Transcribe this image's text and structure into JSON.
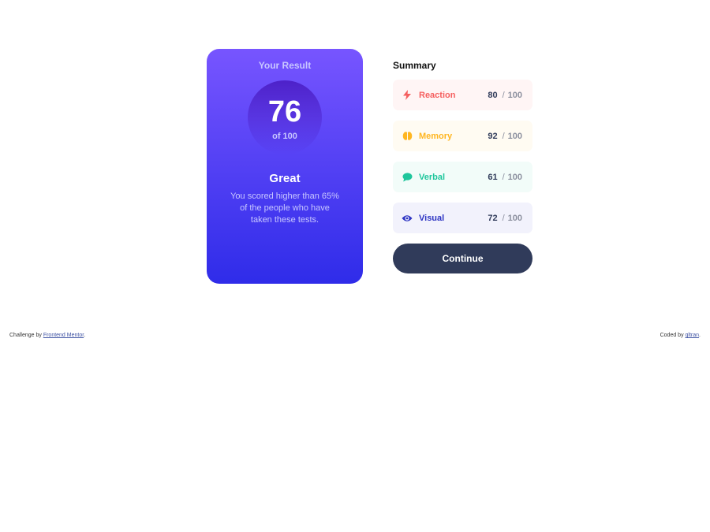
{
  "result": {
    "title": "Your Result",
    "score": "76",
    "out_of": "of 100",
    "rating": "Great",
    "description": "You scored higher than 65% of the people who have taken these tests."
  },
  "summary": {
    "title": "Summary",
    "items": [
      {
        "label": "Reaction",
        "score": "80",
        "sep": "/",
        "max": "100",
        "icon": "lightning-icon",
        "color": "#f55f5f",
        "bg": "#fff5f5"
      },
      {
        "label": "Memory",
        "score": "92",
        "sep": "/",
        "max": "100",
        "icon": "brain-icon",
        "color": "#ffb621",
        "bg": "#fffbf2"
      },
      {
        "label": "Verbal",
        "score": "61",
        "sep": "/",
        "max": "100",
        "icon": "chat-bubble-icon",
        "color": "#1fc69c",
        "bg": "#f2fcf9"
      },
      {
        "label": "Visual",
        "score": "72",
        "sep": "/",
        "max": "100",
        "icon": "eye-icon",
        "color": "#2e35c3",
        "bg": "#f2f2fc"
      }
    ],
    "continue_label": "Continue"
  },
  "footer": {
    "left_prefix": "Challenge by ",
    "left_link": "Frontend Mentor",
    "left_suffix": ".",
    "right_prefix": "Coded by ",
    "right_link": "qltran",
    "right_suffix": "."
  }
}
